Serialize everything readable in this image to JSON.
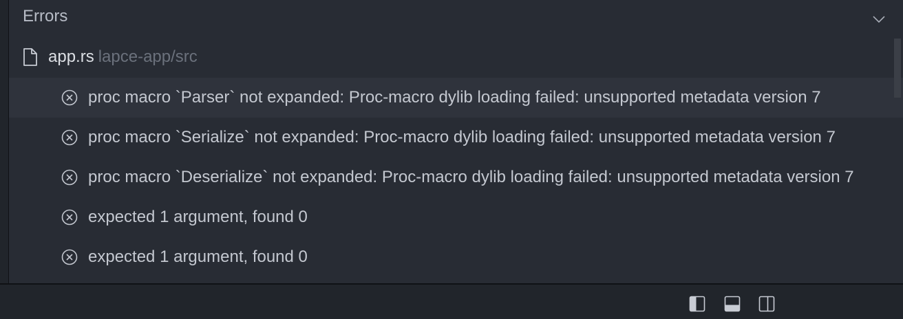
{
  "panel": {
    "title": "Errors",
    "collapse_icon": "chevron-down-icon"
  },
  "file": {
    "icon": "file-icon",
    "name": "app.rs",
    "path": "lapce-app/src"
  },
  "diagnostics": [
    {
      "icon": "error-circle-x-icon",
      "message": "proc macro `Parser` not expanded: Proc-macro dylib loading failed: unsupported metadata version 7"
    },
    {
      "icon": "error-circle-x-icon",
      "message": "proc macro `Serialize` not expanded: Proc-macro dylib loading failed: unsupported metadata version 7"
    },
    {
      "icon": "error-circle-x-icon",
      "message": "proc macro `Deserialize` not expanded: Proc-macro dylib loading failed: unsupported metadata version 7"
    },
    {
      "icon": "error-circle-x-icon",
      "message": "expected 1 argument, found 0"
    },
    {
      "icon": "error-circle-x-icon",
      "message": "expected 1 argument, found 0"
    }
  ],
  "status_bar": {
    "buttons": [
      "toggle-left-panel-icon",
      "toggle-bottom-panel-icon",
      "toggle-right-panel-icon"
    ]
  },
  "colors": {
    "background": "#21252b",
    "panel": "#282c34",
    "active_row": "#2f333c",
    "text": "#c4c8d0",
    "muted_text": "#6b717c"
  }
}
